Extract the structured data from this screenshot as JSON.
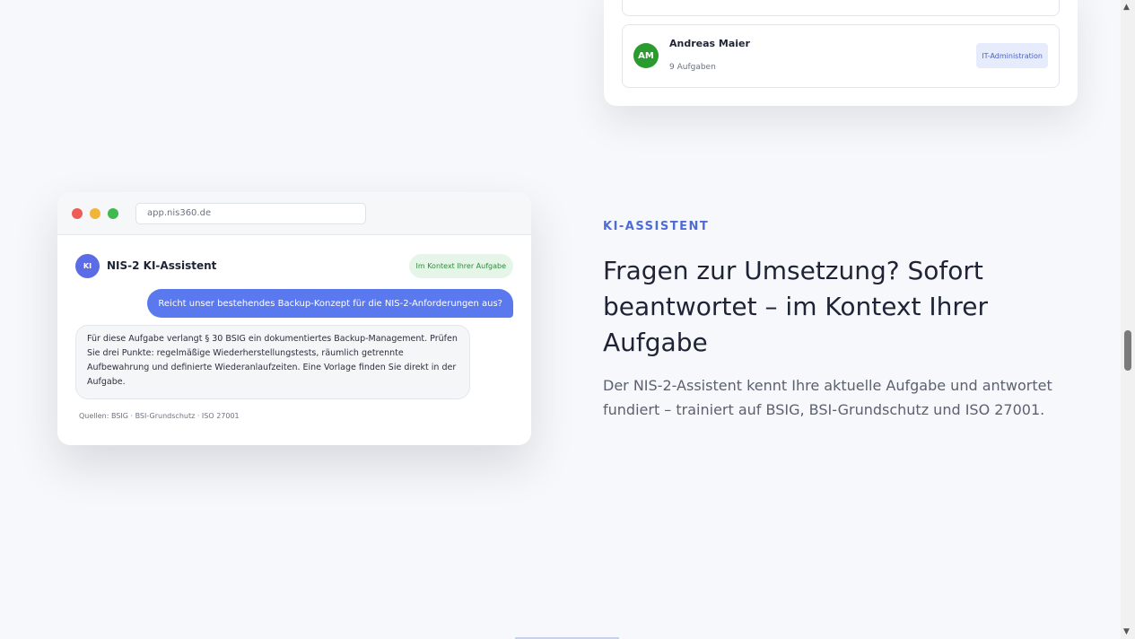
{
  "team_card": {
    "member": {
      "initials": "AM",
      "name": "Andreas Maier",
      "tasks": "9 Aufgaben",
      "role": "IT-Administration",
      "avatar_color": "#2b9a2f"
    }
  },
  "browser": {
    "url": "app.nis360.de",
    "chat": {
      "avatar": "KI",
      "title": "NIS-2 KI-Assistent",
      "context_badge": "Im Kontext Ihrer Aufgabe",
      "user_message": "Reicht unser bestehendes Backup-Konzept für die NIS-2-Anforderungen aus?",
      "bot_message": "Für diese Aufgabe verlangt § 30 BSIG ein dokumentiertes Backup-Management. Prüfen Sie drei Punkte: regelmäßige Wiederherstellungstests, räumlich getrennte Aufbewahrung und definierte Wiederanlaufzeiten. Eine Vorlage finden Sie direkt in der Aufgabe.",
      "sources": "Quellen: BSIG · BSI-Grundschutz · ISO 27001"
    }
  },
  "section": {
    "eyebrow": "KI-ASSISTENT",
    "headline": "Fragen zur Umsetzung? Sofort beantwortet – im Kontext Ihrer Aufgabe",
    "body": "Der NIS-2-Assistent kennt Ihre aktuelle Aufgabe und antwortet fundiert – trainiert auf BSIG, BSI-Grundschutz und ISO 27001."
  },
  "colors": {
    "accent": "#4f6bd6",
    "user_bubble": "#5a79ee",
    "assistant_avatar": "#5b6ce6",
    "context_badge_bg": "#e5f6e8"
  },
  "icons": {
    "window_controls": [
      "close-dot",
      "minimize-dot",
      "maximize-dot"
    ],
    "scroll_up": "triangle-up",
    "scroll_down": "triangle-down"
  }
}
